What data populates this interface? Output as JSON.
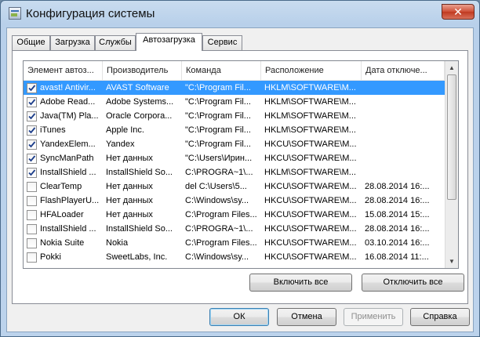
{
  "window": {
    "title": "Конфигурация системы",
    "close_label": "✕"
  },
  "tabs": [
    {
      "label": "Общие"
    },
    {
      "label": "Загрузка"
    },
    {
      "label": "Службы"
    },
    {
      "label": "Автозагрузка",
      "active": true
    },
    {
      "label": "Сервис"
    }
  ],
  "startup": {
    "columns": [
      "Элемент автоз...",
      "Производитель",
      "Команда",
      "Расположение",
      "Дата отключе..."
    ],
    "rows": [
      {
        "checked": true,
        "selected": true,
        "item": "avast! Antivir...",
        "maker": "AVAST Software",
        "command": "\"C:\\Program Fil...",
        "location": "HKLM\\SOFTWARE\\M...",
        "date": ""
      },
      {
        "checked": true,
        "selected": false,
        "item": "Adobe Read...",
        "maker": "Adobe Systems...",
        "command": "\"C:\\Program Fil...",
        "location": "HKLM\\SOFTWARE\\M...",
        "date": ""
      },
      {
        "checked": true,
        "selected": false,
        "item": "Java(TM) Pla...",
        "maker": "Oracle Corpora...",
        "command": "\"C:\\Program Fil...",
        "location": "HKLM\\SOFTWARE\\M...",
        "date": ""
      },
      {
        "checked": true,
        "selected": false,
        "item": "iTunes",
        "maker": "Apple Inc.",
        "command": "\"C:\\Program Fil...",
        "location": "HKLM\\SOFTWARE\\M...",
        "date": ""
      },
      {
        "checked": true,
        "selected": false,
        "item": "YandexElem...",
        "maker": "Yandex",
        "command": "\"C:\\Program Fil...",
        "location": "HKCU\\SOFTWARE\\M...",
        "date": ""
      },
      {
        "checked": true,
        "selected": false,
        "item": "SyncManPath",
        "maker": "Нет данных",
        "command": "\"C:\\Users\\Ирин...",
        "location": "HKCU\\SOFTWARE\\M...",
        "date": ""
      },
      {
        "checked": true,
        "selected": false,
        "item": "InstallShield ...",
        "maker": "InstallShield So...",
        "command": "C:\\PROGRA~1\\...",
        "location": "HKLM\\SOFTWARE\\M...",
        "date": ""
      },
      {
        "checked": false,
        "selected": false,
        "item": "ClearTemp",
        "maker": "Нет данных",
        "command": "del C:\\Users\\5...",
        "location": "HKCU\\SOFTWARE\\M...",
        "date": "28.08.2014 16:..."
      },
      {
        "checked": false,
        "selected": false,
        "item": "FlashPlayerU...",
        "maker": "Нет данных",
        "command": "C:\\Windows\\sy...",
        "location": "HKCU\\SOFTWARE\\M...",
        "date": "28.08.2014 16:..."
      },
      {
        "checked": false,
        "selected": false,
        "item": "HFALoader",
        "maker": "Нет данных",
        "command": "C:\\Program Files...",
        "location": "HKCU\\SOFTWARE\\M...",
        "date": "15.08.2014 15:..."
      },
      {
        "checked": false,
        "selected": false,
        "item": "InstallShield ...",
        "maker": "InstallShield So...",
        "command": "C:\\PROGRA~1\\...",
        "location": "HKCU\\SOFTWARE\\M...",
        "date": "28.08.2014 16:..."
      },
      {
        "checked": false,
        "selected": false,
        "item": "Nokia Suite",
        "maker": "Nokia",
        "command": "C:\\Program Files...",
        "location": "HKCU\\SOFTWARE\\M...",
        "date": "03.10.2014 16:..."
      },
      {
        "checked": false,
        "selected": false,
        "item": "Pokki",
        "maker": "SweetLabs, Inc.",
        "command": "C:\\Windows\\sy...",
        "location": "HKCU\\SOFTWARE\\M...",
        "date": "16.08.2014 11:..."
      }
    ]
  },
  "buttons": {
    "enable_all": "Включить все",
    "disable_all": "Отключить все",
    "ok": "ОК",
    "cancel": "Отмена",
    "apply": "Применить",
    "help": "Справка"
  },
  "colors": {
    "selection": "#3399ff",
    "default_button_border": "#3c7fb1"
  }
}
